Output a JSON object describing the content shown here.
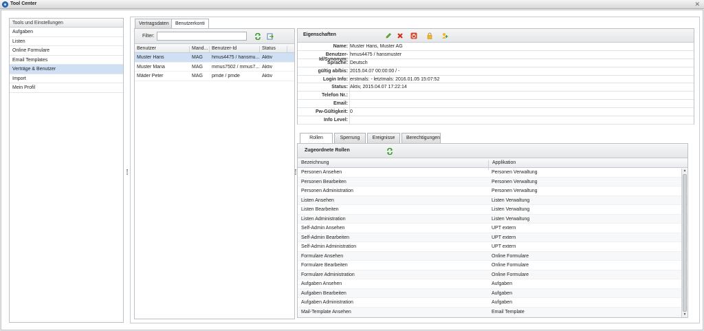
{
  "window": {
    "title": "Tool Center"
  },
  "nav": {
    "header": "Tools und Einstellungen",
    "items": [
      "Aufgaben",
      "Listen",
      "Online Formulare",
      "Email Templates",
      "Verträge & Benutzer",
      "Import",
      "Mein Profil"
    ],
    "active_index": 4
  },
  "tabs": [
    "Vertragsdaten",
    "Benutzerkonti"
  ],
  "active_tab": "Benutzerkonti",
  "users": {
    "filter_label": "Filter:",
    "filter_value": "",
    "columns": [
      "Benutzer",
      "Mand...",
      "Benutzer-Id",
      "Status"
    ],
    "rows": [
      {
        "benutzer": "Muster Hans",
        "mandant": "MAG",
        "id": "hmus4475 / hansmu...",
        "status": "Aktiv"
      },
      {
        "benutzer": "Muster Maria",
        "mandant": "MAG",
        "id": "mmus7502 / mmus7...",
        "status": "Aktiv"
      },
      {
        "benutzer": "Mäder Peter",
        "mandant": "MAG",
        "id": "pmde / pmde",
        "status": "Aktiv"
      }
    ],
    "selected_index": 0
  },
  "properties": {
    "title": "Eigenschaften",
    "rows": [
      {
        "label": "Name:",
        "value": "Muster Hans, Muster AG"
      },
      {
        "label": "Benutzer-Id/Synonym:",
        "value": "hmus4475 / hansmuster"
      },
      {
        "label": "Sprache:",
        "value": "Deutsch"
      },
      {
        "label": "gültig ab/bis:",
        "value": "2015.04.07 00:00:00 / -"
      },
      {
        "label": "Login Info:",
        "value": "erstmals: -    letztmals: 2016.01.05 15:07:52"
      },
      {
        "label": "Status:",
        "value": "Aktiv, 2015.04.07 17:22:14"
      },
      {
        "label": "Telefon Nr.:",
        "value": ""
      },
      {
        "label": "Email:",
        "value": ""
      },
      {
        "label": "Pw-Gültigkeit:",
        "value": "0"
      },
      {
        "label": "Info Level:",
        "value": ""
      }
    ]
  },
  "role_tabs": [
    "Rollen",
    "Sperrung",
    "Ereignisse",
    "Berechtigungen"
  ],
  "roles": {
    "title": "Zugeordnete Rollen",
    "columns": [
      "Bezeichnung",
      "Applikation"
    ],
    "rows": [
      {
        "name": "Personen Ansehen",
        "app": "Personen Verwaltung"
      },
      {
        "name": "Personen Bearbeiten",
        "app": "Personen Verwaltung"
      },
      {
        "name": "Personen Administration",
        "app": "Personen Verwaltung"
      },
      {
        "name": "Listen Ansehen",
        "app": "Listen Verwaltung"
      },
      {
        "name": "Listen Bearbeiten",
        "app": "Listen Verwaltung"
      },
      {
        "name": "Listen Administration",
        "app": "Listen Verwaltung"
      },
      {
        "name": "Self-Admin Ansehen",
        "app": "UPT extern"
      },
      {
        "name": "Self-Admin Bearbeiten",
        "app": "UPT extern"
      },
      {
        "name": "Self-Admin Administration",
        "app": "UPT extern"
      },
      {
        "name": "Formulare Ansehen",
        "app": "Online Formulare"
      },
      {
        "name": "Formulare Bearbeiten",
        "app": "Online Formulare"
      },
      {
        "name": "Formulare Administration",
        "app": "Online Formulare"
      },
      {
        "name": "Aufgaben Ansehen",
        "app": "Aufgaben"
      },
      {
        "name": "Aufgaben Bearbeiten",
        "app": "Aufgaben"
      },
      {
        "name": "Aufgaben Administration",
        "app": "Aufgaben"
      },
      {
        "name": "Mail-Template Ansehen",
        "app": "Email Template"
      }
    ]
  },
  "icons": {
    "refresh": "refresh-icon",
    "export": "export-icon",
    "edit": "pencil-icon",
    "delete": "delete-icon",
    "power": "power-icon",
    "lock": "lock-icon",
    "add_user": "add-user-icon"
  },
  "colors": {
    "selection": "#cfe0f5",
    "accent": "#2f6fc0"
  }
}
